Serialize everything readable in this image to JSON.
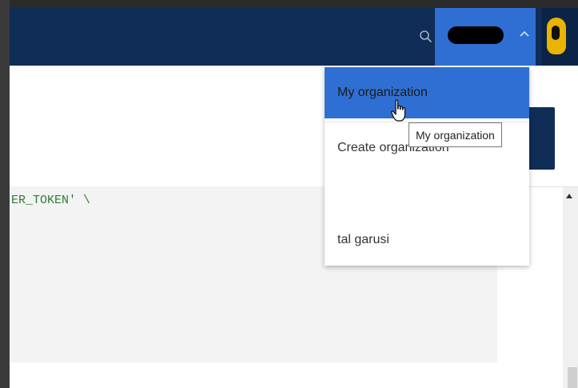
{
  "header": {
    "search_icon": "search-icon",
    "account_chevron_icon": "chevron-up-icon"
  },
  "account_menu": {
    "items": [
      {
        "label": "My organization",
        "active": true
      },
      {
        "label": "Create organization",
        "active": false
      },
      {
        "label": "tal garusi",
        "active": false
      }
    ]
  },
  "tooltip": {
    "text": "My organization"
  },
  "code": {
    "line1": "ER_TOKEN' \\"
  },
  "colors": {
    "header_bg": "#0f2d57",
    "accent_blue": "#2f6fd3",
    "code_bg": "#f3f3f3",
    "code_text": "#2e7d32"
  }
}
